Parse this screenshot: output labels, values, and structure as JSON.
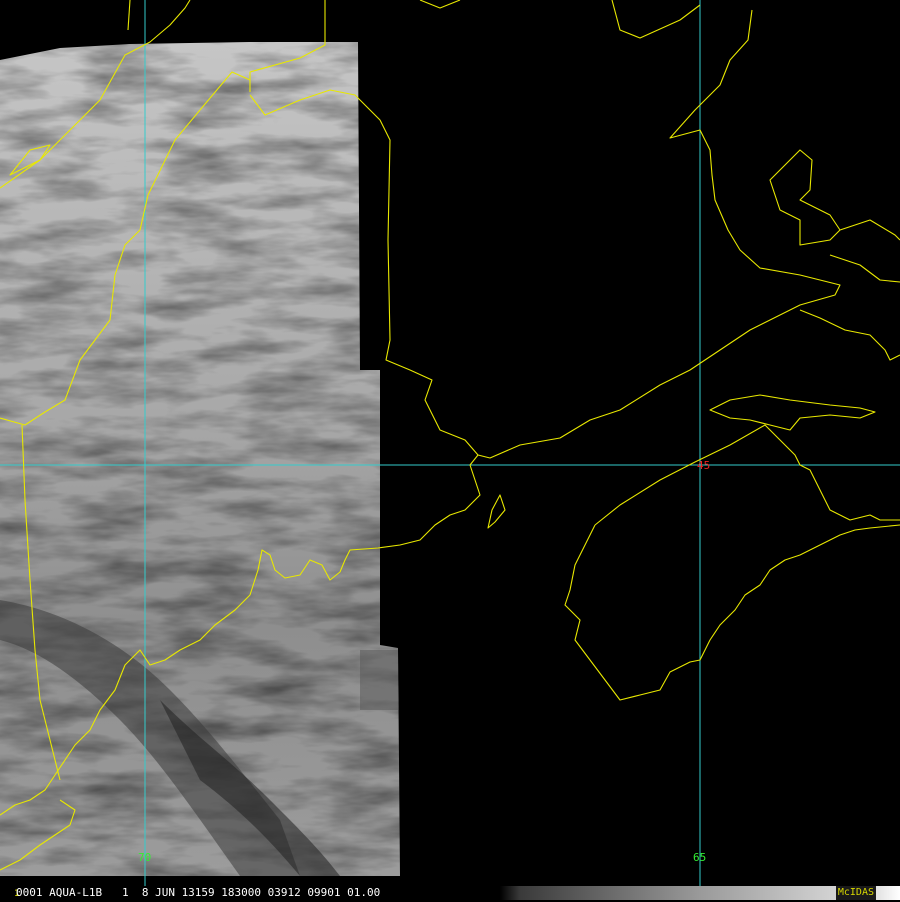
{
  "map": {
    "lon_labels": [
      "70",
      "65"
    ],
    "lat_label": "45",
    "colors": {
      "coastline": "#e8e800",
      "gridline": "#33cccc",
      "lon_label": "#33ee33",
      "lat_label": "#ee2222",
      "no_data": "#000000"
    }
  },
  "status_bar": {
    "frame_number": "1",
    "text": "0001 AQUA-L1B   1  8 JUN 13159 183000 03912 09901 01.00",
    "brand": "McIDAS"
  }
}
